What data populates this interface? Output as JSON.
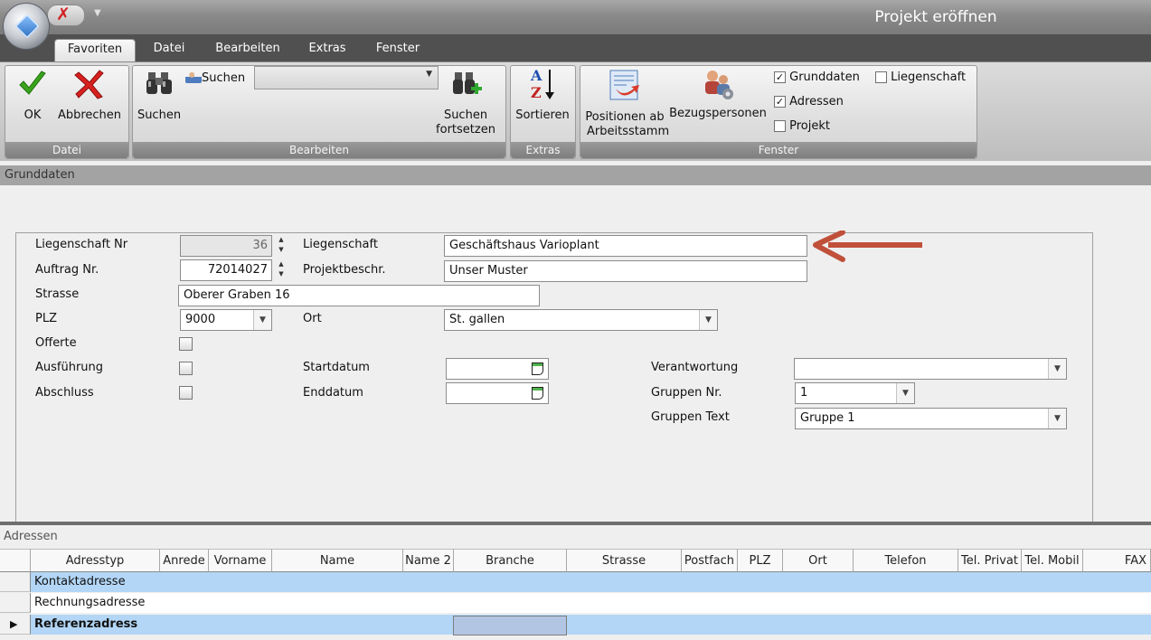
{
  "window": {
    "title": "Projekt eröffnen",
    "close_glyph": "✗",
    "dropdown_glyph": "▼"
  },
  "tabs": [
    {
      "label": "Favoriten",
      "active": true
    },
    {
      "label": "Datei"
    },
    {
      "label": "Bearbeiten"
    },
    {
      "label": "Extras"
    },
    {
      "label": "Fenster"
    }
  ],
  "ribbon": {
    "datei": {
      "label": "Datei",
      "ok": "OK",
      "abbrechen": "Abbrechen"
    },
    "bearbeiten": {
      "label": "Bearbeiten",
      "suchen_small": "Suchen",
      "suchen": "Suchen",
      "search_value": "",
      "suchen_fortsetzen_1": "Suchen",
      "suchen_fortsetzen_2": "fortsetzen"
    },
    "extras": {
      "label": "Extras",
      "sortieren": "Sortieren"
    },
    "fenster": {
      "label": "Fenster",
      "positionen_1": "Positionen ab",
      "positionen_2": "Arbeitsstamm",
      "bezugspersonen": "Bezugspersonen",
      "cb_grunddaten": {
        "label": "Grunddaten",
        "checked": true
      },
      "cb_liegenschaft": {
        "label": "Liegenschaft",
        "checked": false
      },
      "cb_adressen": {
        "label": "Adressen",
        "checked": true
      },
      "cb_projekt": {
        "label": "Projekt",
        "checked": false
      }
    }
  },
  "grunddaten": {
    "header": "Grunddaten",
    "labels": {
      "liegenschaft_nr": "Liegenschaft Nr",
      "auftrag_nr": "Auftrag Nr.",
      "strasse": "Strasse",
      "plz": "PLZ",
      "offerte": "Offerte",
      "ausfuehrung": "Ausführung",
      "abschluss": "Abschluss",
      "liegenschaft": "Liegenschaft",
      "projektbeschr": "Projektbeschr.",
      "ort": "Ort",
      "startdatum": "Startdatum",
      "enddatum": "Enddatum",
      "verantwortung": "Verantwortung",
      "gruppen_nr": "Gruppen Nr.",
      "gruppen_text": "Gruppen Text"
    },
    "values": {
      "liegenschaft_nr": "36",
      "auftrag_nr": "72014027",
      "strasse": "Oberer Graben 16",
      "plz": "9000",
      "liegenschaft": "Geschäftshaus Varioplant",
      "projektbeschr": "Unser Muster",
      "ort": "St. gallen",
      "startdatum": "",
      "enddatum": "",
      "verantwortung": "",
      "gruppen_nr": "1",
      "gruppen_text": "Gruppe 1"
    },
    "checkboxes": {
      "offerte": false,
      "ausfuehrung": false,
      "abschluss": false
    }
  },
  "adressen": {
    "title": "Adressen",
    "columns": [
      "Adresstyp",
      "Anrede",
      "Vorname",
      "Name",
      "Name 2",
      "Branche",
      "Strasse",
      "Postfach",
      "PLZ",
      "Ort",
      "Telefon",
      "Tel. Privat",
      "Tel. Mobil",
      "FAX"
    ],
    "rows": [
      {
        "adresstyp": "Kontaktadresse"
      },
      {
        "adresstyp": "Rechnungsadresse"
      },
      {
        "adresstyp": "Referenzadress",
        "current": true
      }
    ],
    "current_row_glyph": "▶"
  },
  "colors": {
    "accent_arrow": "#c0503a",
    "row_highlight": "#b3d6f6",
    "cell_selection": "#b2c6e4",
    "ok_check": "#3aa41c",
    "cancel_x": "#d8211f"
  }
}
